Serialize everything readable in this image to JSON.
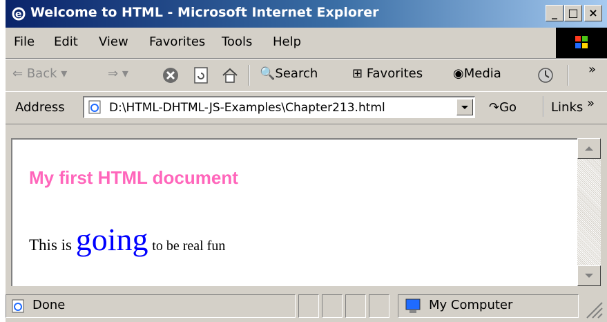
{
  "window": {
    "title": "Welcome to HTML - Microsoft Internet Explorer"
  },
  "title_buttons": {
    "minimize": "_",
    "maximize": "□",
    "close": "×"
  },
  "menu": [
    {
      "label": "File"
    },
    {
      "label": "Edit"
    },
    {
      "label": "View"
    },
    {
      "label": "Favorites"
    },
    {
      "label": "Tools"
    },
    {
      "label": "Help"
    }
  ],
  "toolbar": {
    "back": "Back",
    "search": "Search",
    "favorites": "Favorites",
    "media": "Media",
    "more": "»"
  },
  "address": {
    "label": "Address",
    "value": "D:\\HTML-DHTML-JS-Examples\\Chapter213.html",
    "go": "Go",
    "links": "Links",
    "more": "»"
  },
  "content": {
    "heading": "My first HTML document",
    "text_before": "This is",
    "text_big": "going",
    "text_after": "to be real fun"
  },
  "status": {
    "text": "Done",
    "zone": "My Computer"
  },
  "colors": {
    "heading": "#ff66bb",
    "emphasis": "#0000ff",
    "title_bar": "#0a246a"
  }
}
